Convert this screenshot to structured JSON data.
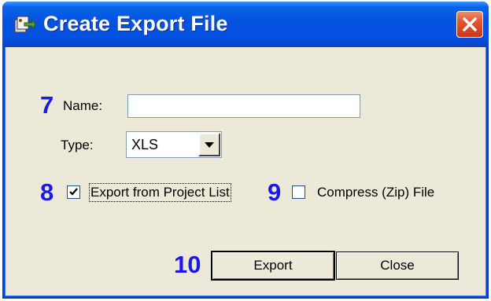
{
  "window": {
    "title": "Create Export File",
    "icon": "export-app-icon",
    "close_icon": "close-icon"
  },
  "form": {
    "name_label": "Name:",
    "name_value": "",
    "type_label": "Type:",
    "type_value": "XLS",
    "export_from_project_list_label": "Export from Project List",
    "export_from_project_list_checked": true,
    "compress_label": "Compress (Zip) File",
    "compress_checked": false
  },
  "steps": {
    "name": "7",
    "export_from_list": "8",
    "compress": "9",
    "export": "10"
  },
  "buttons": {
    "export_label": "Export",
    "close_label": "Close"
  },
  "colors": {
    "title_bar": "#0352df",
    "step_number": "#1a1ae6",
    "dialog_background": "#ece9d8",
    "close_button": "#e2552f"
  }
}
